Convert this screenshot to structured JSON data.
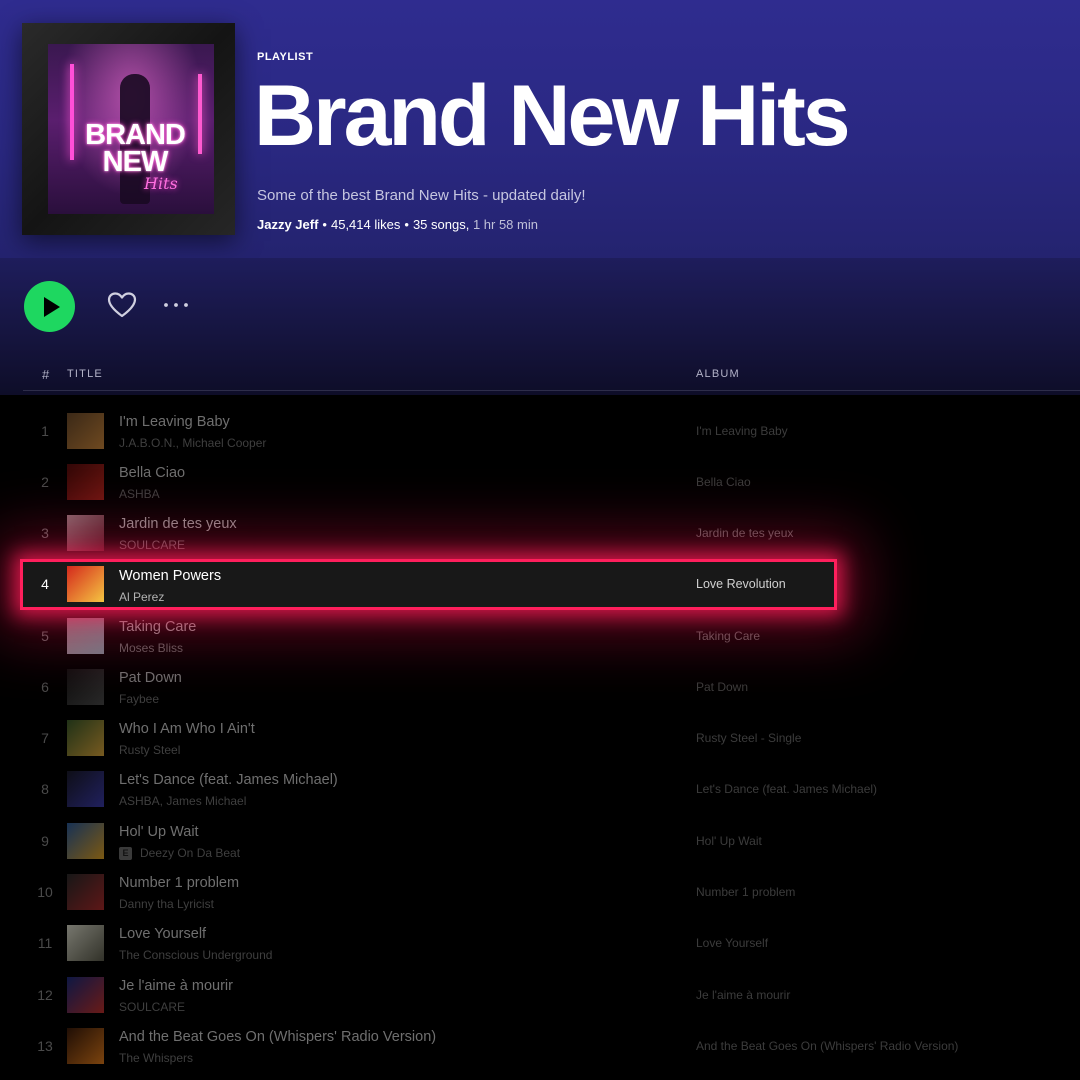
{
  "playlist": {
    "type": "PLAYLIST",
    "title": "Brand New Hits",
    "description": "Some of the best Brand New Hits - updated daily!",
    "owner": "Jazzy Jeff",
    "likes": "45,414 likes",
    "songs": "35 songs,",
    "duration": "1 hr 58 min",
    "cover": {
      "line1": "BRAND",
      "line2": "NEW",
      "line3": "Hits"
    }
  },
  "actions": {
    "play_icon": "play-icon",
    "heart_icon": "heart-icon",
    "more_icon": "more-icon"
  },
  "table_header": {
    "number": "#",
    "title": "TITLE",
    "album": "ALBUM"
  },
  "colors": {
    "accent": "#1ed760",
    "highlight": "#ff1f5c",
    "header_bg": "#2f2c8f"
  },
  "tracks": [
    {
      "num": "1",
      "title": "I'm Leaving Baby",
      "artist": "J.A.B.O.N., Michael Cooper",
      "album": "I'm Leaving Baby",
      "explicit": false,
      "thumb": [
        "#6b4a2a",
        "#c9853a"
      ]
    },
    {
      "num": "2",
      "title": "Bella Ciao",
      "artist": "ASHBA",
      "album": "Bella Ciao",
      "explicit": false,
      "thumb": [
        "#5a0c0c",
        "#c3281e"
      ]
    },
    {
      "num": "3",
      "title": "Jardin de tes yeux",
      "artist": "SOULCARE",
      "album": "Jardin de tes yeux",
      "explicit": false,
      "thumb": [
        "#e9b8c3",
        "#7a2a3a"
      ]
    },
    {
      "num": "4",
      "title": "Women Powers",
      "artist": "Al Perez",
      "album": "Love Revolution",
      "explicit": false,
      "thumb": [
        "#d4281c",
        "#f5c542"
      ]
    },
    {
      "num": "5",
      "title": "Taking Care",
      "artist": "Moses Bliss",
      "album": "Taking Care",
      "explicit": false,
      "thumb": [
        "#f0c4d6",
        "#c4e0f0"
      ]
    },
    {
      "num": "6",
      "title": "Pat Down",
      "artist": "Faybee",
      "album": "Pat Down",
      "explicit": false,
      "thumb": [
        "#1a1a1a",
        "#4a4a4a"
      ]
    },
    {
      "num": "7",
      "title": "Who I Am Who I Ain't",
      "artist": "Rusty Steel",
      "album": "Rusty Steel - Single",
      "explicit": false,
      "thumb": [
        "#3a5a2a",
        "#d9a43a"
      ]
    },
    {
      "num": "8",
      "title": "Let's Dance (feat. James Michael)",
      "artist": "ASHBA, James Michael",
      "album": "Let's Dance (feat. James Michael)",
      "explicit": false,
      "thumb": [
        "#1a1a2a",
        "#3a3aaa"
      ]
    },
    {
      "num": "9",
      "title": "Hol' Up Wait",
      "artist": "Deezy On Da Beat",
      "album": "Hol' Up Wait",
      "explicit": true,
      "explicit_label": "E",
      "thumb": [
        "#2a5a9a",
        "#e0a020"
      ]
    },
    {
      "num": "10",
      "title": "Number 1 problem",
      "artist": "Danny tha Lyricist",
      "album": "Number 1 problem",
      "explicit": false,
      "thumb": [
        "#2a2a2a",
        "#aa2a2a"
      ]
    },
    {
      "num": "11",
      "title": "Love Yourself",
      "artist": "The Conscious Underground",
      "album": "Love Yourself",
      "explicit": false,
      "thumb": [
        "#d8d8c8",
        "#5a5a4a"
      ]
    },
    {
      "num": "12",
      "title": "Je l'aime à mourir",
      "artist": "SOULCARE",
      "album": "Je l'aime à mourir",
      "explicit": false,
      "thumb": [
        "#1a2a7a",
        "#c0302a"
      ]
    },
    {
      "num": "13",
      "title": "And the Beat Goes On (Whispers' Radio Version)",
      "artist": "The Whispers",
      "album": "And the Beat Goes On (Whispers' Radio Version)",
      "explicit": false,
      "thumb": [
        "#3a1a0a",
        "#e07a1a"
      ]
    }
  ]
}
